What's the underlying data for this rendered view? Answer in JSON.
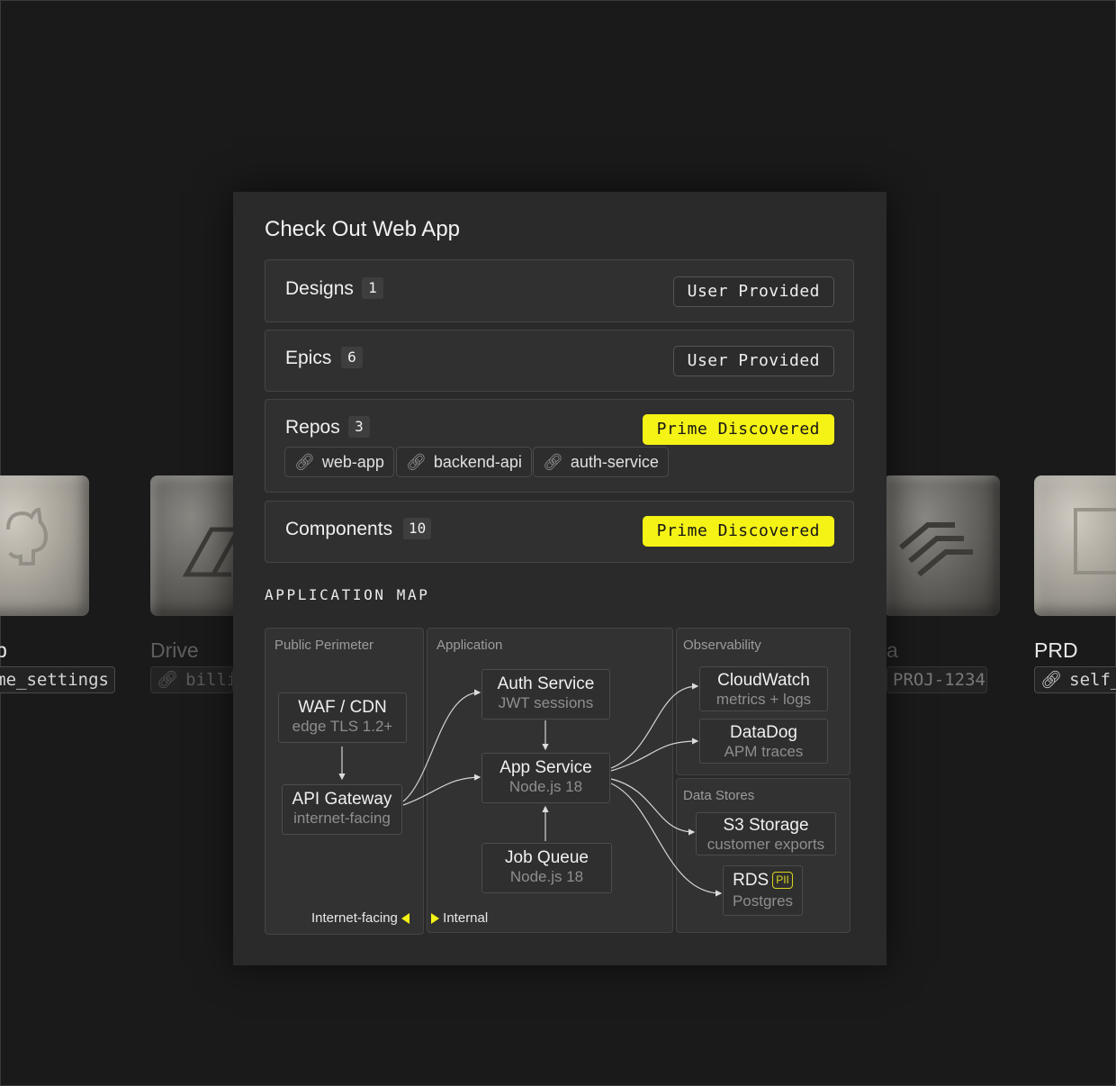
{
  "background": {
    "tiles": [
      {
        "label": "b",
        "chip": "me_settings"
      },
      {
        "label": "Drive",
        "chip": "billi"
      },
      {
        "label": "a",
        "chip": "PROJ-1234"
      },
      {
        "label": "PRD",
        "chip": "self_"
      }
    ]
  },
  "panel": {
    "title": "Check Out Web App",
    "rows": [
      {
        "title": "Designs",
        "count": "1",
        "badge": "User Provided"
      },
      {
        "title": "Epics",
        "count": "6",
        "badge": "User Provided"
      },
      {
        "title": "Repos",
        "count": "3",
        "badge": "Prime Discovered",
        "repos": [
          "web-app",
          "backend-api",
          "auth-service"
        ]
      },
      {
        "title": "Components",
        "count": "10",
        "badge": "Prime Discovered"
      }
    ],
    "section_title": "APPLICATION MAP"
  },
  "map": {
    "zones": {
      "public": "Public Perimeter",
      "application": "Application",
      "observability": "Observability",
      "datastores": "Data Stores"
    },
    "nodes": {
      "waf": {
        "name": "WAF / CDN",
        "sub": "edge TLS 1.2+"
      },
      "gateway": {
        "name": "API Gateway",
        "sub": "internet-facing"
      },
      "auth": {
        "name": "Auth Service",
        "sub": "JWT sessions"
      },
      "app": {
        "name": "App Service",
        "sub": "Node.js 18"
      },
      "queue": {
        "name": "Job Queue",
        "sub": "Node.js 18"
      },
      "cloudwatch": {
        "name": "CloudWatch",
        "sub": "metrics + logs"
      },
      "datadog": {
        "name": "DataDog",
        "sub": "APM traces"
      },
      "s3": {
        "name": "S3 Storage",
        "sub": "customer exports"
      },
      "rds": {
        "name": "RDS",
        "sub": "Postgres",
        "tag": "PII"
      }
    },
    "legend": {
      "internet": "Internet-facing",
      "internal": "Internal"
    }
  },
  "colors": {
    "accent": "#f5f216",
    "panel": "#2a2a2a",
    "background": "#1a1a1a"
  }
}
